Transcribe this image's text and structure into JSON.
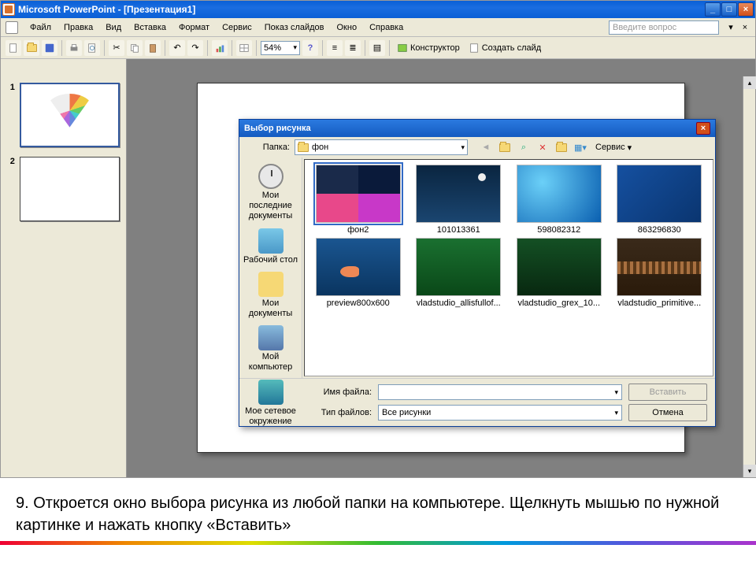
{
  "title": "Microsoft PowerPoint - [Презентация1]",
  "menu": {
    "file": "Файл",
    "edit": "Правка",
    "view": "Вид",
    "insert": "Вставка",
    "format": "Формат",
    "service": "Сервис",
    "show": "Показ слайдов",
    "window": "Окно",
    "help": "Справка"
  },
  "askbox": "Введите вопрос",
  "zoom": "54%",
  "toolbar": {
    "designer": "Конструктор",
    "newslide": "Создать слайд"
  },
  "thumbs": {
    "n1": "1",
    "n2": "2"
  },
  "dialog": {
    "title": "Выбор рисунка",
    "folderlabel": "Папка:",
    "folder": "фон",
    "servicebtn": "Сервис",
    "places": {
      "recent": "Мои последние документы",
      "desktop": "Рабочий стол",
      "mydocs": "Мои документы",
      "mycomp": "Мой компьютер",
      "network": "Мое сетевое окружение"
    },
    "files": {
      "f1": "фон2",
      "f2": "101013361",
      "f3": "598082312",
      "f4": "863296830",
      "f5": "preview800x600",
      "f6": "vladstudio_allisfullof...",
      "f7": "vladstudio_grex_10...",
      "f8": "vladstudio_primitive..."
    },
    "filenamelbl": "Имя файла:",
    "filename": "",
    "filetypelbl": "Тип файлов:",
    "filetype": "Все рисунки",
    "insertbtn": "Вставить",
    "cancelbtn": "Отмена"
  },
  "caption": "9.   Откроется окно выбора рисунка из любой папки на компьютере. Щелкнуть мышью по нужной картинке и нажать кнопку «Вставить»"
}
